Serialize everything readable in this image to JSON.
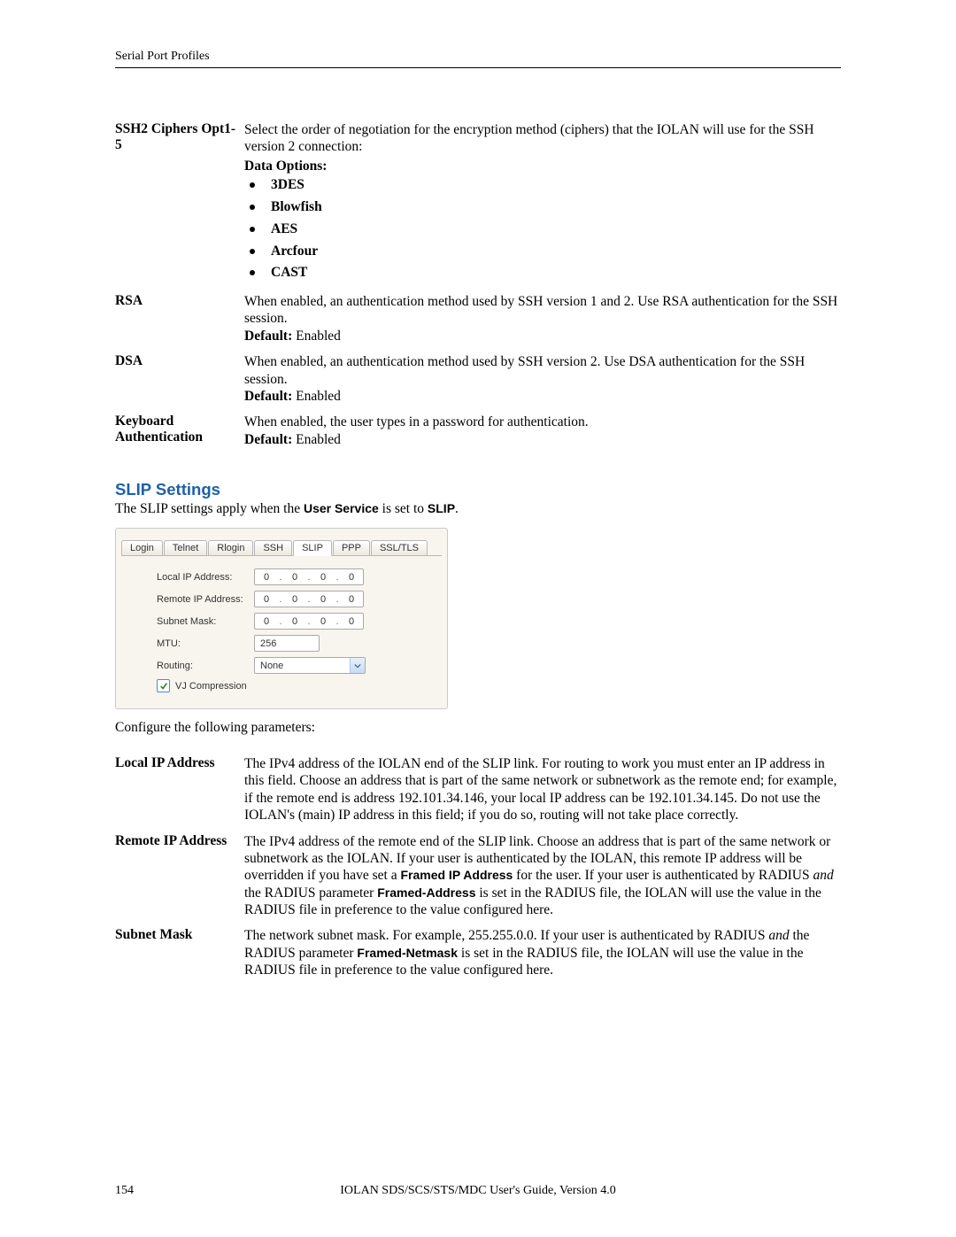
{
  "header": {
    "title": "Serial Port Profiles"
  },
  "defs1": {
    "ssh2": {
      "label": "SSH2 Ciphers Opt1-5",
      "desc": "Select the order of negotiation for the encryption method (ciphers) that the IOLAN will use for the SSH version 2 connection:",
      "dataOptionsLabel": "Data Options:",
      "bullets": [
        "3DES",
        "Blowfish",
        "AES",
        "Arcfour",
        "CAST"
      ]
    },
    "rsa": {
      "label": "RSA",
      "desc": "When enabled, an authentication method used by SSH version 1 and 2. Use RSA authentication for the SSH session.",
      "defaultLabel": "Default:",
      "defaultValue": "Enabled"
    },
    "dsa": {
      "label": "DSA",
      "desc": "When enabled, an authentication method used by SSH version 2. Use DSA authentication for the SSH session.",
      "defaultLabel": "Default:",
      "defaultValue": "Enabled"
    },
    "kbd": {
      "label": "Keyboard Authentication",
      "desc": "When enabled, the user types in a password for authentication.",
      "defaultLabel": "Default:",
      "defaultValue": "Enabled"
    }
  },
  "section": {
    "title": "SLIP Settings",
    "intro_pre": "The SLIP settings apply when the ",
    "intro_bold1": "User Service",
    "intro_mid": " is set to ",
    "intro_bold2": "SLIP",
    "intro_end": "."
  },
  "panel": {
    "tabs": [
      "Login",
      "Telnet",
      "Rlogin",
      "SSH",
      "SLIP",
      "PPP",
      "SSL/TLS"
    ],
    "activeTab": "SLIP",
    "labels": {
      "localIp": "Local IP Address:",
      "remoteIp": "Remote IP Address:",
      "subnet": "Subnet Mask:",
      "mtu": "MTU:",
      "routing": "Routing:",
      "vj": "VJ Compression"
    },
    "values": {
      "localIp": [
        "0",
        "0",
        "0",
        "0"
      ],
      "remoteIp": [
        "0",
        "0",
        "0",
        "0"
      ],
      "subnet": [
        "0",
        "0",
        "0",
        "0"
      ],
      "mtu": "256",
      "routing": "None",
      "vjChecked": true
    }
  },
  "configure": "Configure the following parameters:",
  "defs2": {
    "localIp": {
      "label": "Local IP Address",
      "desc": "The IPv4 address of the IOLAN end of the SLIP link. For routing to work you must enter an IP address in this field. Choose an address that is part of the same network or subnetwork as the remote end; for example, if the remote end is address 192.101.34.146, your local IP address can be 192.101.34.145. Do not use the IOLAN's (main) IP address in this field; if you do so, routing will not take place correctly."
    },
    "remoteIp": {
      "label": "Remote IP Address",
      "pre": "The IPv4 address of the remote end of the SLIP link. Choose an address that is part of the same network or subnetwork as the IOLAN. If your user is authenticated by the IOLAN, this remote IP address will be overridden if you have set a ",
      "b1": "Framed IP Address",
      "mid1": " for the user. If your user is authenticated by RADIUS ",
      "it1": "and",
      "mid2": " the RADIUS parameter ",
      "b2": "Framed-Address",
      "post": " is set in the RADIUS file, the IOLAN will use the value in the RADIUS file in preference to the value configured here."
    },
    "subnet": {
      "label": "Subnet Mask",
      "pre": "The network subnet mask. For example, 255.255.0.0. If your user is authenticated by RADIUS ",
      "it1": "and",
      "mid": " the RADIUS parameter ",
      "b1": "Framed-Netmask",
      "post": " is set in the RADIUS file, the IOLAN will use the value in the RADIUS file in preference to the value configured here."
    }
  },
  "footer": {
    "pageNum": "154",
    "footerText": "IOLAN SDS/SCS/STS/MDC User's Guide, Version 4.0"
  }
}
